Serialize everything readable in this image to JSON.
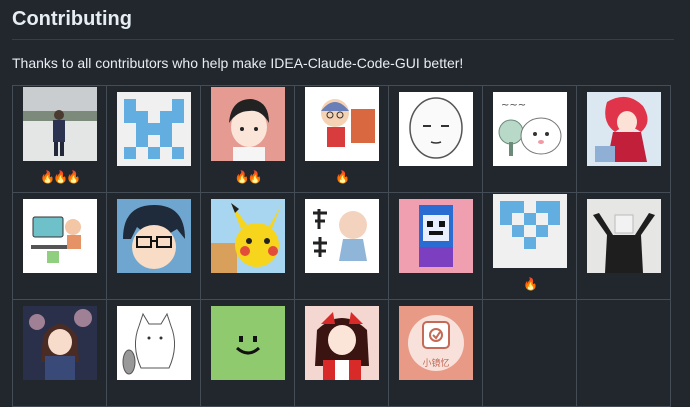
{
  "section": {
    "heading": "Contributing",
    "intro": "Thanks to all contributors who help make IDEA-Claude-Code-GUI better!"
  },
  "contributors": [
    {
      "avatar": "photo-man-in-snow",
      "fire": "🔥🔥🔥"
    },
    {
      "avatar": "identicon-blue",
      "fire": ""
    },
    {
      "avatar": "anime-boy-pink",
      "fire": "🔥🔥"
    },
    {
      "avatar": "cartoon-kid-bricks",
      "fire": "🔥"
    },
    {
      "avatar": "meme-face-sketch",
      "fire": ""
    },
    {
      "avatar": "cat-with-fan",
      "fire": ""
    },
    {
      "avatar": "anime-girl-red",
      "fire": ""
    },
    {
      "avatar": "cartoon-desk-worker",
      "fire": ""
    },
    {
      "avatar": "cartoon-glasses-boy",
      "fire": ""
    },
    {
      "avatar": "pikachu",
      "fire": ""
    },
    {
      "avatar": "chinese-ink-baby",
      "fire": ""
    },
    {
      "avatar": "pixel-robot",
      "fire": ""
    },
    {
      "avatar": "identicon-heart-blue",
      "fire": "🔥"
    },
    {
      "avatar": "photo-man-arms-up",
      "fire": ""
    },
    {
      "avatar": "anime-girl-night",
      "fire": ""
    },
    {
      "avatar": "cat-sketch",
      "fire": ""
    },
    {
      "avatar": "green-smile",
      "fire": ""
    },
    {
      "avatar": "anime-shrine-maiden",
      "fire": ""
    },
    {
      "avatar": "xiaotanyi-logo",
      "fire": ""
    }
  ],
  "logo_text": "小镜忆"
}
